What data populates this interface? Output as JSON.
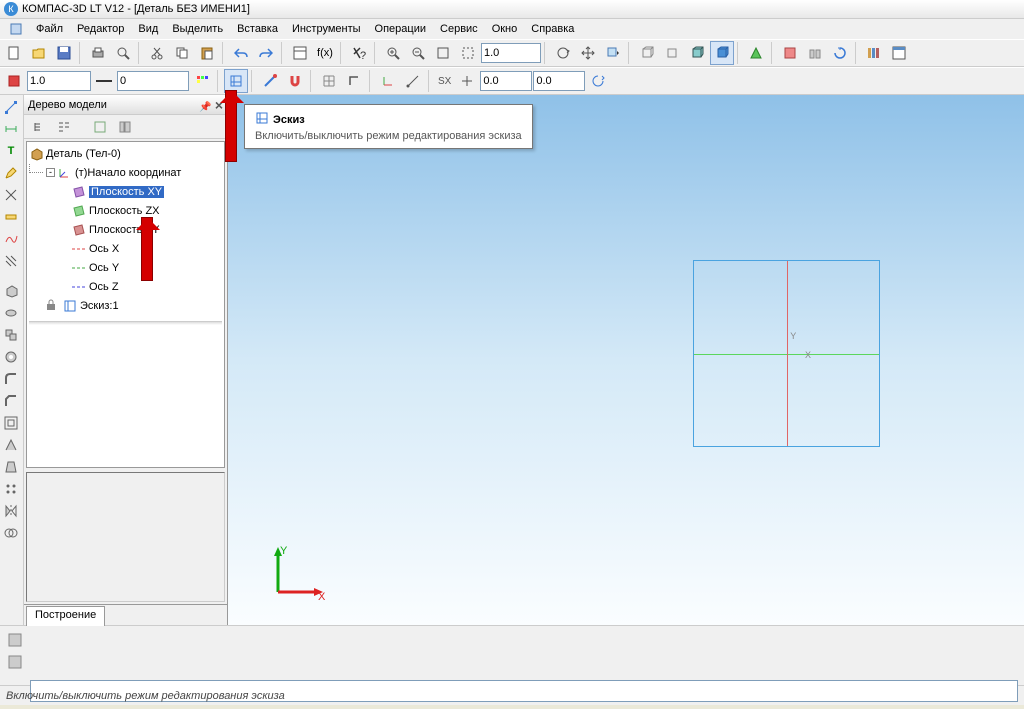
{
  "title": "КОМПАС-3D LT V12 - [Деталь БЕЗ ИМЕНИ1]",
  "menus": [
    "Файл",
    "Редактор",
    "Вид",
    "Выделить",
    "Вставка",
    "Инструменты",
    "Операции",
    "Сервис",
    "Окно",
    "Справка"
  ],
  "toolbar2": {
    "scale": "1.0",
    "layer": "0",
    "zoom": "1.0",
    "x": "0.0",
    "y": "0.0",
    "sx_label": "SX"
  },
  "panel": {
    "title": "Дерево модели",
    "root": "Деталь (Тел-0)",
    "origin": "(т)Начало координат",
    "planes": [
      "Плоскость XY",
      "Плоскость ZX",
      "Плоскость ZY"
    ],
    "axes": [
      "Ось X",
      "Ось Y",
      "Ось Z"
    ],
    "sketch": "Эскиз:1",
    "tab": "Построение"
  },
  "tooltip": {
    "title": "Эскиз",
    "body": "Включить/выключить режим редактирования эскиза"
  },
  "status": "Включить/выключить режим редактирования эскиза",
  "axis_labels": {
    "x": "X",
    "y": "Y"
  }
}
